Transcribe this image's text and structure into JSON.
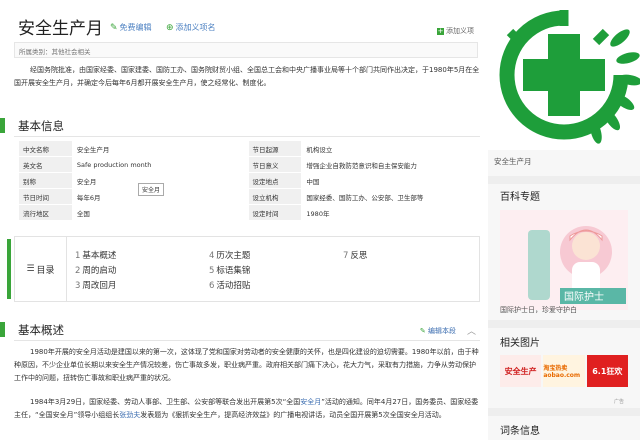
{
  "header": {
    "title": "安全生产月",
    "edit_label": "免费编辑",
    "add_tag_label": "添加义项名",
    "add_synonym_label": "添加义项"
  },
  "category": "所属类别：其他社会相关",
  "intro": "经国务院批准，由国家经委、国家建委、国防工办、国务院财贸小组、全国总工会和中央广播事业局等十个部门共同作出决定，于1980年5月在全国开展安全生产月，并确定今后每年6月都开展安全生产月，使之经常化、制度化。",
  "basic_info": {
    "heading": "基本信息",
    "rows": [
      {
        "k1": "中文名称",
        "v1": "安全生产月",
        "k2": "节日起源",
        "v2": "机构设立"
      },
      {
        "k1": "英文名",
        "v1": "Safe production month",
        "k2": "节日意义",
        "v2": "增强企业自救防范意识和自主保安能力"
      },
      {
        "k1": "别称",
        "v1": "安全月",
        "k2": "设定地点",
        "v2": "中国"
      },
      {
        "k1": "节日时间",
        "v1": "每年6月",
        "k2": "设立机构",
        "v2": "国家经委、国防工办、公安部、卫生部等"
      },
      {
        "k1": "流行地区",
        "v1": "全国",
        "k2": "设定时间",
        "v2": "1980年"
      }
    ],
    "tooltip": "安全月"
  },
  "catalog": {
    "label": "目录",
    "items": [
      {
        "num": "1",
        "text": "基本概述"
      },
      {
        "num": "2",
        "text": "周的启动"
      },
      {
        "num": "3",
        "text": "周改回月"
      },
      {
        "num": "4",
        "text": "历次主题"
      },
      {
        "num": "5",
        "text": "标语集锦"
      },
      {
        "num": "6",
        "text": "活动招贴"
      },
      {
        "num": "7",
        "text": "反思"
      }
    ]
  },
  "overview": {
    "heading": "基本概述",
    "edit_label": "编辑本段",
    "para1": "1980年开展的安全月活动是建国以来的第一次，这体现了党和国家对劳动者的安全健康的关怀，也是四化建设的迫切需要。1980年以前，由于种种原因，不少企业单位长期以来安全生产情况较差，伤亡事故多发，职业病严重。政府相关部门痛下决心，花大力气，采取有力措施，力争从劳动保护工作中的问题，扭转伤亡事故和职业病严重的状况。",
    "para2_a": "1984年3月29日，国家经委、劳动人事部、卫生部、公安部等联合发出开展第5次“全国",
    "para2_link1": "安全月",
    "para2_b": "”活动的通知。同年4月27日，国务委员、国家经委主任，“全国安全月”领导小组组长",
    "para2_link2": "张劲夫",
    "para2_c": "发表题为《狠抓安全生产，提高经济效益》的广播电视讲话，动员全国开展第5次全国安全月活动。"
  },
  "sidebar": {
    "logo_caption": "安全生产月",
    "special_heading": "百科专题",
    "promo_caption": "国际护士日，珍爱守护白",
    "related_heading": "相关图片",
    "thumbs": [
      "安全生产",
      "淘宝热卖 aobao.com",
      "6.1狂欢"
    ],
    "ad_label": "广告",
    "entry_heading": "词条信息"
  },
  "colors": {
    "accent": "#3aa53a",
    "link": "#3b6db0",
    "logo_green": "#1e9e3a"
  }
}
